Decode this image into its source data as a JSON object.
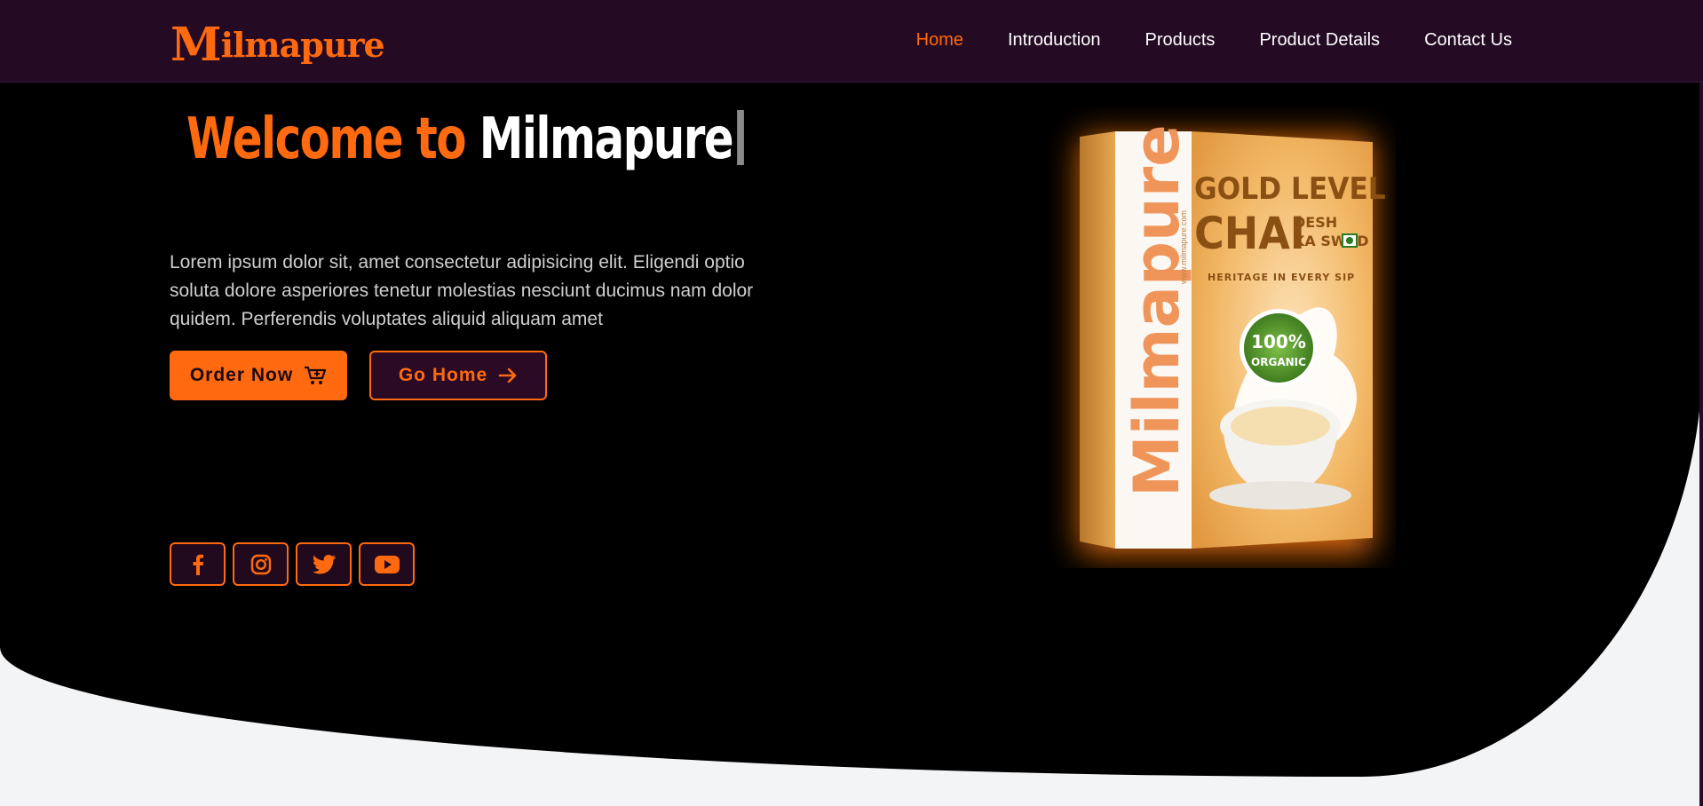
{
  "brand": {
    "logo_text": "Milmapure"
  },
  "nav": {
    "items": [
      {
        "label": "Home",
        "active": true
      },
      {
        "label": "Introduction"
      },
      {
        "label": "Products"
      },
      {
        "label": "Product Details"
      },
      {
        "label": "Contact Us"
      }
    ]
  },
  "hero": {
    "headline_prefix": "Welcome to ",
    "headline_brand": "Milmapure",
    "description": "Lorem ipsum dolor sit, amet consectetur adipisicing elit. Eligendi optio soluta dolore asperiores tenetur molestias nesciunt ducimus nam dolor quidem. Perferendis voluptates aliquid aliquam amet",
    "order_button": "Order Now",
    "home_button": "Go Home"
  },
  "socials": [
    "facebook-icon",
    "instagram-icon",
    "twitter-icon",
    "youtube-icon"
  ],
  "product": {
    "brand_text": "Milmapure",
    "website": "www.milmapure.com",
    "line1": "GOLD LEVEL",
    "line2": "CHAI",
    "tag1": "DESH",
    "tag2": "KA SWAD",
    "tagline": "HERITAGE IN EVERY SIP",
    "badge_pct": "100%",
    "badge_text": "ORGANIC"
  },
  "colors": {
    "accent": "#ff6a10",
    "header_bg": "#240a22",
    "hero_bg": "#000000",
    "page_bg": "#f3f4f6"
  }
}
